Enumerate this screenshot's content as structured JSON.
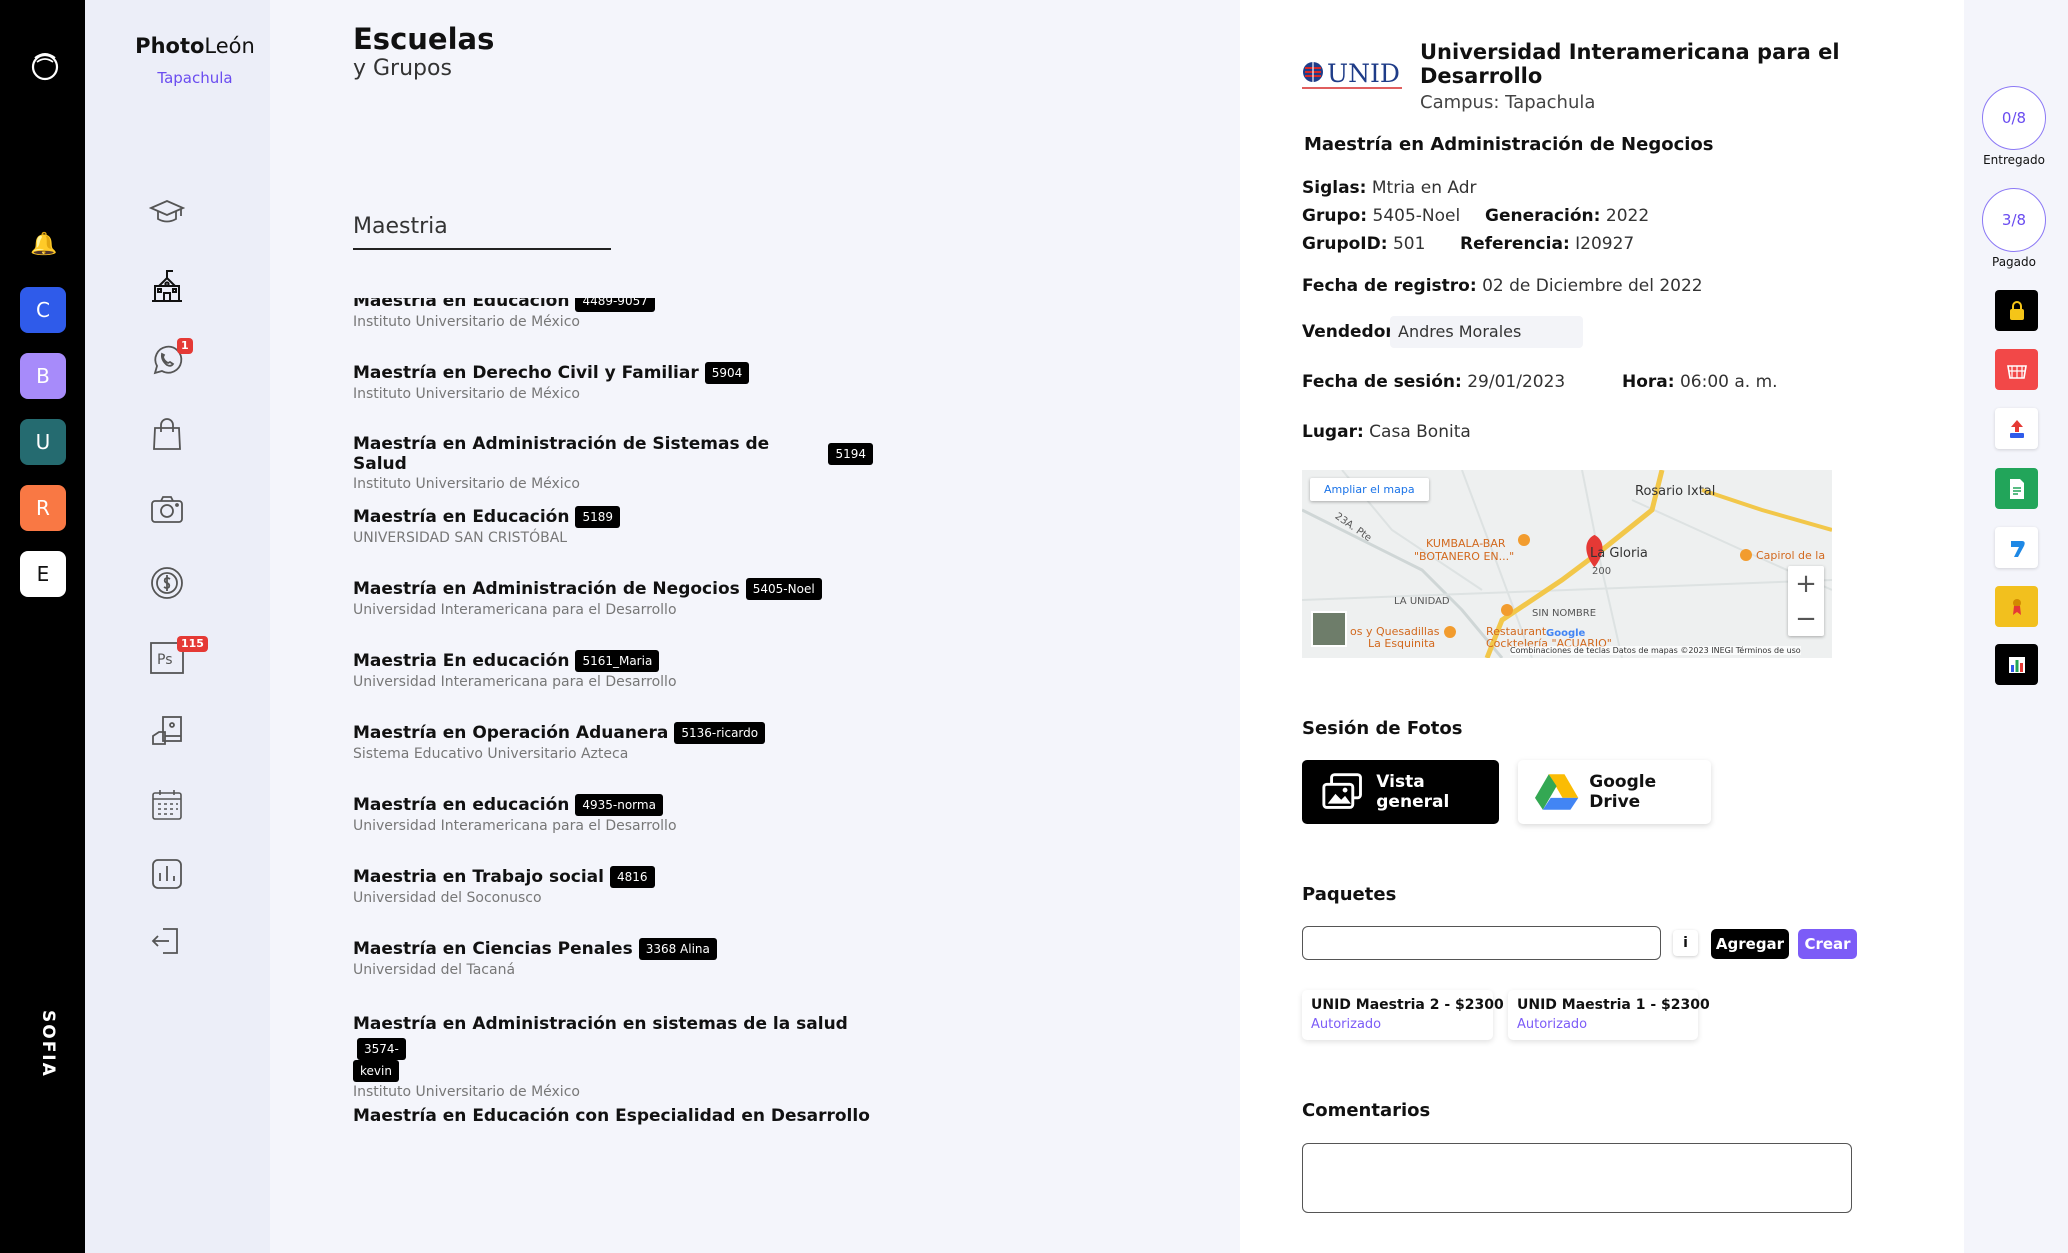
{
  "workspaces": [
    {
      "letter": "C",
      "color": "#2f5bea"
    },
    {
      "letter": "B",
      "color": "#a78bfa"
    },
    {
      "letter": "U",
      "color": "#256b70"
    },
    {
      "letter": "R",
      "color": "#f97844"
    },
    {
      "letter": "E",
      "color": "#ffffff"
    }
  ],
  "rail": {
    "sofia": "SOFIA"
  },
  "brand": {
    "bold": "Photo",
    "light": "León",
    "branch": "Tapachula"
  },
  "nav_badges": {
    "whatsapp": "1",
    "photoshop": "115"
  },
  "page": {
    "title": "Escuelas",
    "subtitle": "y Grupos"
  },
  "search": {
    "value": "Maestria"
  },
  "groups": [
    {
      "title": "Maestría en Educación",
      "tag": "4489-9057",
      "school": "Instituto Universitario de México"
    },
    {
      "title": "Maestría en Derecho Civil y Familiar",
      "tag": "5904",
      "school": "Instituto Universitario de México"
    },
    {
      "title": "Maestría en Administración de Sistemas de Salud",
      "tag": "5194",
      "school": "Instituto Universitario de México"
    },
    {
      "title": "Maestría en Educación",
      "tag": "5189",
      "school": "UNIVERSIDAD SAN CRISTÓBAL"
    },
    {
      "title": "Maestría en Administración de Negocios",
      "tag": "5405-Noel",
      "school": "Universidad Interamericana para el Desarrollo"
    },
    {
      "title": "Maestria En educación",
      "tag": "5161_Maria",
      "school": "Universidad Interamericana para el Desarrollo"
    },
    {
      "title": "Maestría en Operación Aduanera",
      "tag": "5136-ricardo",
      "school": "Sistema Educativo Universitario Azteca"
    },
    {
      "title": "Maestría en educación",
      "tag": "4935-norma",
      "school": "Universidad Interamericana para el Desarrollo"
    },
    {
      "title": "Maestria en Trabajo social",
      "tag": "4816",
      "school": "Universidad del Soconusco"
    },
    {
      "title": "Maestría en Ciencias Penales",
      "tag": "3368 Alina",
      "school": "Universidad del Tacaná"
    }
  ],
  "group_long": {
    "title": "Maestría en Administración en sistemas de la salud",
    "tag_a": "3574-",
    "tag_b": "kevin",
    "school": "Instituto Universitario de México"
  },
  "group_cut": {
    "title": "Maestría en Educación con Especialidad en Desarrollo del"
  },
  "detail": {
    "logo_text": "UNID",
    "university": "Universidad Interamericana para el Desarrollo",
    "campus_label": "Campus:",
    "campus": "Tapachula",
    "program": "Maestría en Administración de Negocios",
    "siglas_label": "Siglas:",
    "siglas": "Mtria en Adr",
    "grupo_label": "Grupo:",
    "grupo": "5405-Noel",
    "generacion_label": "Generación:",
    "generacion": "2022",
    "grupoid_label": "GrupoID:",
    "grupoid": "501",
    "referencia_label": "Referencia:",
    "referencia": "I20927",
    "registro_label": "Fecha de registro:",
    "registro": "02 de Diciembre del 2022",
    "vendedor_label": "Vendedor:",
    "vendedor": "Andres Morales",
    "sesion_label": "Fecha de sesión:",
    "sesion": "29/01/2023",
    "hora_label": "Hora:",
    "hora": "06:00 a. m.",
    "lugar_label": "Lugar:",
    "lugar": "Casa Bonita"
  },
  "map": {
    "link": "Ampliar el mapa",
    "labels": {
      "rosario": "Rosario Ixtal",
      "gloria": "La Gloria",
      "kumbala": "KUMBALA-BAR",
      "botanero": "\"BOTANERO EN...\"",
      "unidad": "LA UNIDAD",
      "sinnombre": "SIN NOMBRE",
      "capirol": "Capirol de la",
      "quesadillas": "os y Quesadillas",
      "esquinita": "La Esquinita",
      "restaurant": "Restaurant",
      "cockteleria": "Cocktelería \"ACUARIO\"",
      "road": "23A. Pte",
      "route": "200"
    },
    "footer": "Combinaciones de teclas   Datos de mapas ©2023 INEGI   Términos de uso",
    "google": "Google"
  },
  "session": {
    "title": "Sesión de Fotos",
    "overview": "Vista general",
    "drive": "Google Drive"
  },
  "packages": {
    "title": "Paquetes",
    "info": "i",
    "add": "Agregar",
    "create": "Crear",
    "items": [
      {
        "name": "UNID Maestria 2 - $2300",
        "status": "Autorizado"
      },
      {
        "name": "UNID Maestria 1 - $2300",
        "status": "Autorizado"
      }
    ]
  },
  "comments": {
    "title": "Comentarios"
  },
  "progress": {
    "delivered": "0/8",
    "delivered_label": "Entregado",
    "paid": "3/8",
    "paid_label": "Pagado"
  },
  "tool_colors": [
    "#000000",
    "#f24848",
    "#ffffff",
    "#22a55a",
    "#ffffff",
    "#f2c01e",
    "#000000"
  ]
}
